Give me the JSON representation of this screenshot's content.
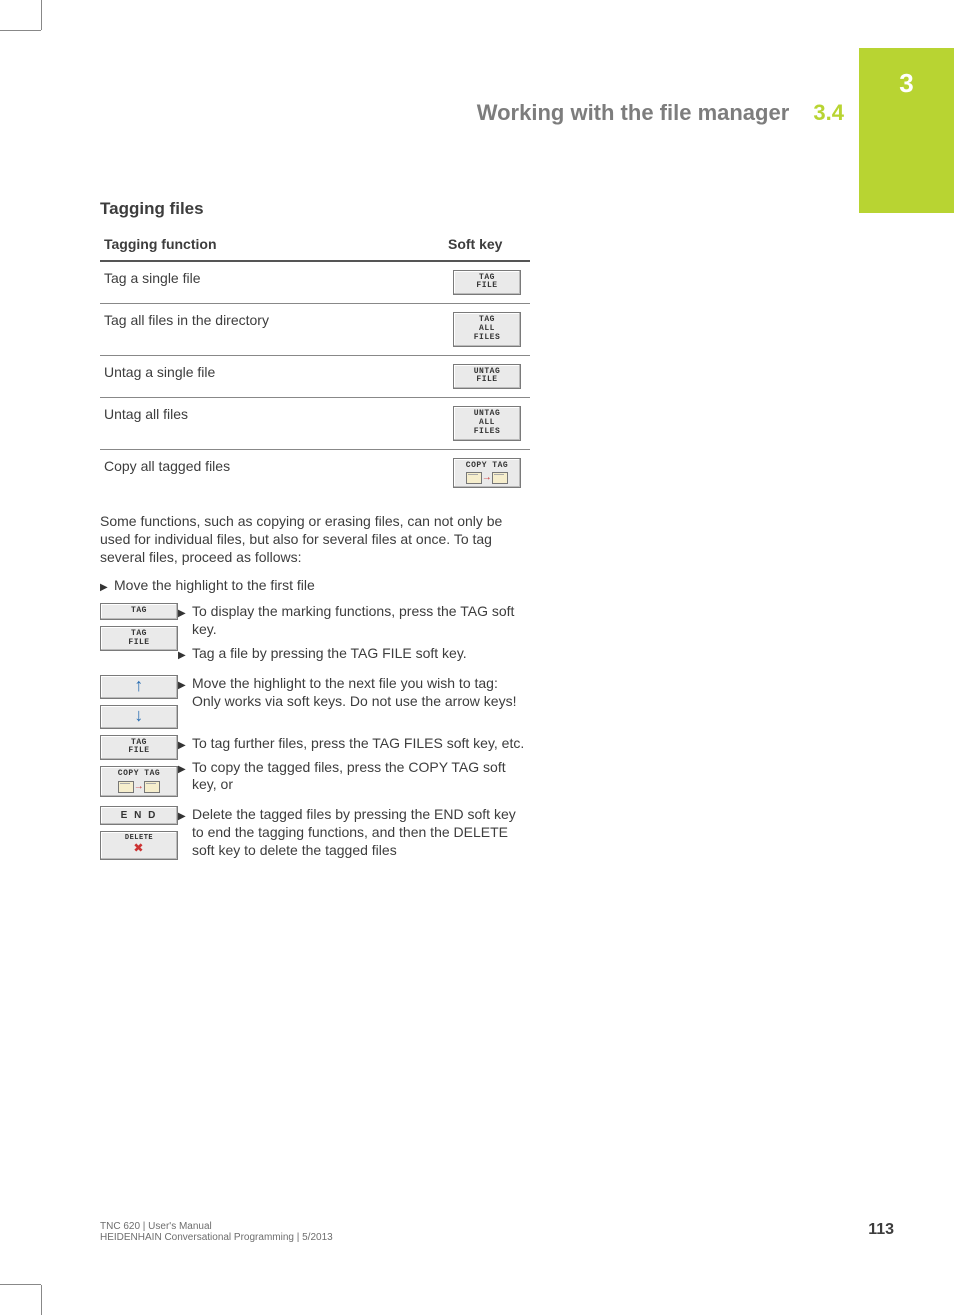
{
  "chapter_tab": "3",
  "running_header": {
    "title": "Working with the file manager",
    "section": "3.4"
  },
  "heading": "Tagging files",
  "table": {
    "col1": "Tagging function",
    "col2": "Soft key",
    "rows": [
      {
        "fn": "Tag a single file",
        "key": "TAG\nFILE"
      },
      {
        "fn": "Tag all files in the directory",
        "key": "TAG\nALL\nFILES"
      },
      {
        "fn": "Untag a single file",
        "key": "UNTAG\nFILE"
      },
      {
        "fn": "Untag all files",
        "key": "UNTAG\nALL\nFILES"
      },
      {
        "fn": "Copy all tagged files",
        "key": "COPY TAG",
        "copyicon": true
      }
    ]
  },
  "intro": "Some functions, such as copying or erasing files, can not only be used for individual files, but also for several files at once. To tag several files, proceed as follows:",
  "step0": "Move the highlight to the first file",
  "ksteps": [
    {
      "keys": [
        {
          "t": "TAG"
        },
        {
          "t": "TAG\nFILE"
        }
      ],
      "lines": [
        "To display the marking functions, press the TAG soft key.",
        "Tag a file by pressing the TAG FILE soft key."
      ]
    },
    {
      "keys": [
        {
          "arrow": "↑"
        },
        {
          "arrow": "↓"
        }
      ],
      "lines": [
        "Move the highlight to the next file you wish to tag: Only works via soft keys. Do not use the arrow keys!"
      ]
    },
    {
      "keys": [
        {
          "t": "TAG\nFILE"
        },
        {
          "t": "COPY TAG",
          "copyicon": true
        }
      ],
      "lines": [
        "To tag further files, press the TAG FILES soft key, etc.",
        "To copy the tagged files, press the COPY TAG soft key, or"
      ]
    },
    {
      "keys": [
        {
          "end": true,
          "t": "E N D"
        },
        {
          "del": true,
          "t": "DELETE"
        }
      ],
      "lines": [
        "Delete the tagged files by pressing the END soft key to end the tagging functions, and then the DELETE soft key to delete the tagged files"
      ]
    }
  ],
  "footer": {
    "l1": "TNC 620 | User's Manual",
    "l2": "HEIDENHAIN Conversational Programming | 5/2013",
    "page": "113"
  }
}
